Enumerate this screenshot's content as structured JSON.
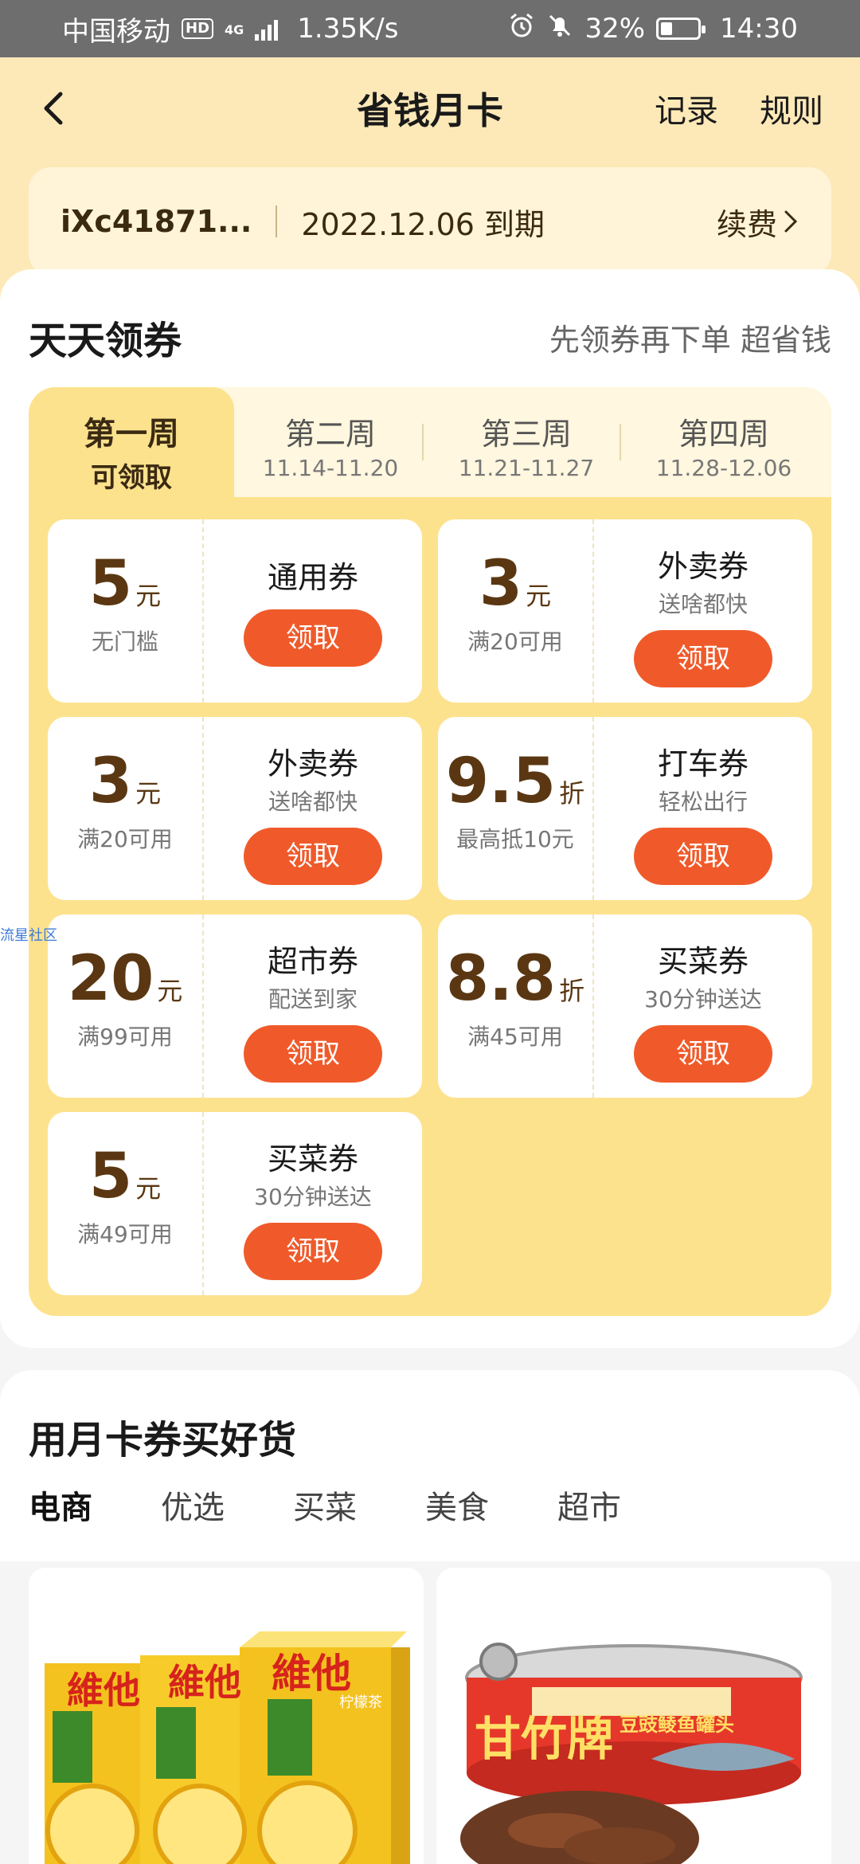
{
  "status_bar": {
    "carrier": "中国移动",
    "hd": "HD",
    "network": "4G",
    "speed": "1.35K/s",
    "battery": "32%",
    "time": "14:30"
  },
  "nav": {
    "title": "省钱月卡",
    "records": "记录",
    "rules": "规则"
  },
  "member": {
    "user_id": "iXc41871...",
    "expiry": "2022.12.06 到期",
    "renew": "续费"
  },
  "coupon_section": {
    "title": "天天领券",
    "subtitle": "先领券再下单 超省钱",
    "weeks": [
      {
        "name": "第一周",
        "date": "可领取"
      },
      {
        "name": "第二周",
        "date": "11.14-11.20"
      },
      {
        "name": "第三周",
        "date": "11.21-11.27"
      },
      {
        "name": "第四周",
        "date": "11.28-12.06"
      }
    ],
    "coupons": [
      {
        "amount": "5",
        "unit": "元",
        "condition": "无门槛",
        "type": "通用券",
        "sub": "",
        "button": "领取"
      },
      {
        "amount": "3",
        "unit": "元",
        "condition": "满20可用",
        "type": "外卖券",
        "sub": "送啥都快",
        "button": "领取"
      },
      {
        "amount": "3",
        "unit": "元",
        "condition": "满20可用",
        "type": "外卖券",
        "sub": "送啥都快",
        "button": "领取"
      },
      {
        "amount": "9.5",
        "unit": "折",
        "condition": "最高抵10元",
        "type": "打车券",
        "sub": "轻松出行",
        "button": "领取"
      },
      {
        "amount": "20",
        "unit": "元",
        "condition": "满99可用",
        "type": "超市券",
        "sub": "配送到家",
        "button": "领取"
      },
      {
        "amount": "8.8",
        "unit": "折",
        "condition": "满45可用",
        "type": "买菜券",
        "sub": "30分钟送达",
        "button": "领取"
      },
      {
        "amount": "5",
        "unit": "元",
        "condition": "满49可用",
        "type": "买菜券",
        "sub": "30分钟送达",
        "button": "领取"
      }
    ],
    "watermark": "流星社区"
  },
  "goods_section": {
    "title": "用月卡券买好货",
    "categories": [
      "电商",
      "优选",
      "买菜",
      "美食",
      "超市"
    ],
    "products": [
      {
        "brand_text": "維他",
        "flavor_text": "柠檬茶"
      },
      {
        "brand_text": "甘竹牌",
        "label_text": "豆豉鲮鱼罐头"
      }
    ]
  },
  "colors": {
    "header_bg": "#fde9b8",
    "week_area_bg": "#fde28e",
    "button_orange": "#f05a2a",
    "amount_brown": "#5a3712",
    "tab_underline": "#f8c443"
  }
}
